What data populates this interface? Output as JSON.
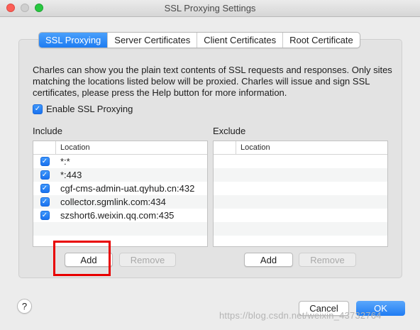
{
  "window": {
    "title": "SSL Proxying Settings"
  },
  "tabs": [
    {
      "label": "SSL Proxying",
      "active": true
    },
    {
      "label": "Server Certificates",
      "active": false
    },
    {
      "label": "Client Certificates",
      "active": false
    },
    {
      "label": "Root Certificate",
      "active": false
    }
  ],
  "description": "Charles can show you the plain text contents of SSL requests and responses. Only sites matching the locations listed below will be proxied. Charles will issue and sign SSL certificates, please press the Help button for more information.",
  "enable_ssl": {
    "label": "Enable SSL Proxying",
    "checked": true
  },
  "include": {
    "label": "Include",
    "column_header": "Location",
    "rows": [
      {
        "location": "*:*",
        "checked": true
      },
      {
        "location": "*:443",
        "checked": true
      },
      {
        "location": "cgf-cms-admin-uat.qyhub.cn:432",
        "checked": true
      },
      {
        "location": "collector.sgmlink.com:434",
        "checked": true
      },
      {
        "location": "szshort6.weixin.qq.com:435",
        "checked": true
      }
    ],
    "add_label": "Add",
    "remove_label": "Remove"
  },
  "exclude": {
    "label": "Exclude",
    "column_header": "Location",
    "rows": [],
    "add_label": "Add",
    "remove_label": "Remove"
  },
  "footer": {
    "help_label": "?",
    "cancel_label": "Cancel",
    "ok_label": "OK",
    "watermark": "https://blog.csdn.net/weixin_43732764"
  },
  "colors": {
    "accent": "#1e7cf2",
    "highlight_border": "#e80000"
  },
  "icons": {
    "checkbox": "check-icon",
    "help": "question-icon"
  }
}
